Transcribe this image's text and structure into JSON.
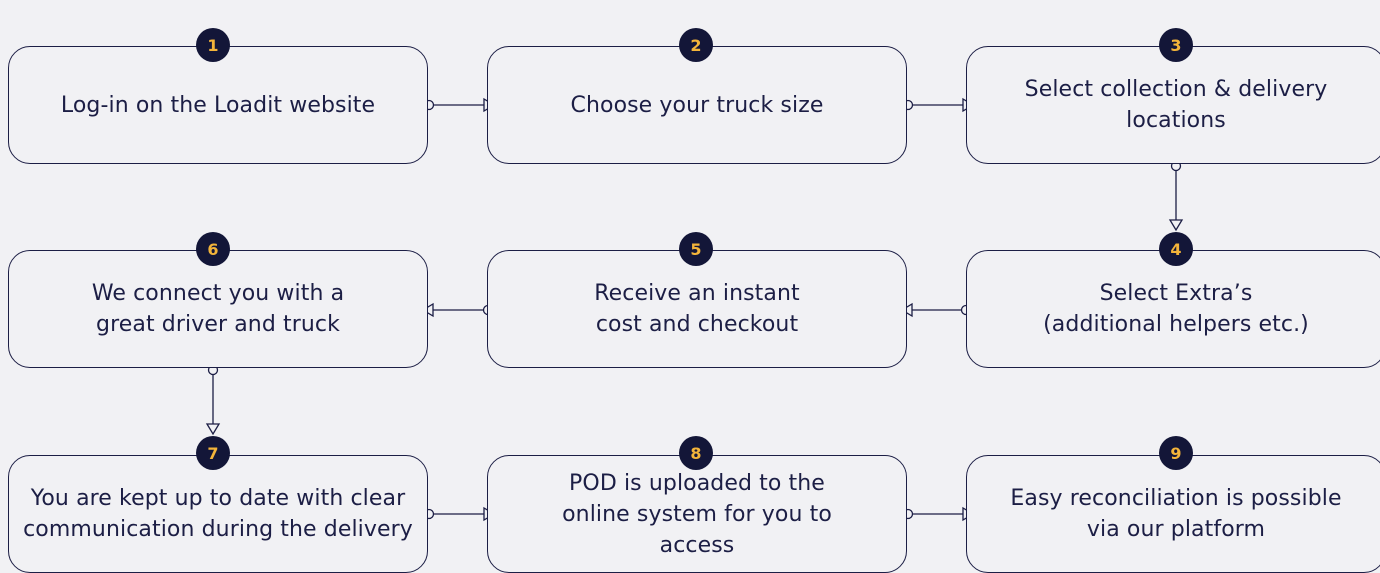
{
  "colors": {
    "background": "#f1f1f4",
    "ink": "#1c1e45",
    "badge_fill": "#131638",
    "badge_number": "#f3b43a"
  },
  "steps": [
    {
      "number": "1",
      "text": "Log-in on the Loadit website"
    },
    {
      "number": "2",
      "text": "Choose your truck size"
    },
    {
      "number": "3",
      "text": "Select collection & delivery locations"
    },
    {
      "number": "4",
      "text": "Select Extra’s (additional helpers etc.)"
    },
    {
      "number": "5",
      "text": "Receive an instant cost and checkout"
    },
    {
      "number": "6",
      "text": "We connect you with a great driver and truck"
    },
    {
      "number": "7",
      "text": "You are kept up to date with clear communication during the delivery"
    },
    {
      "number": "8",
      "text": "POD is uploaded to the online system for you to access"
    },
    {
      "number": "9",
      "text": "Easy reconciliation is possible via our platform"
    }
  ]
}
